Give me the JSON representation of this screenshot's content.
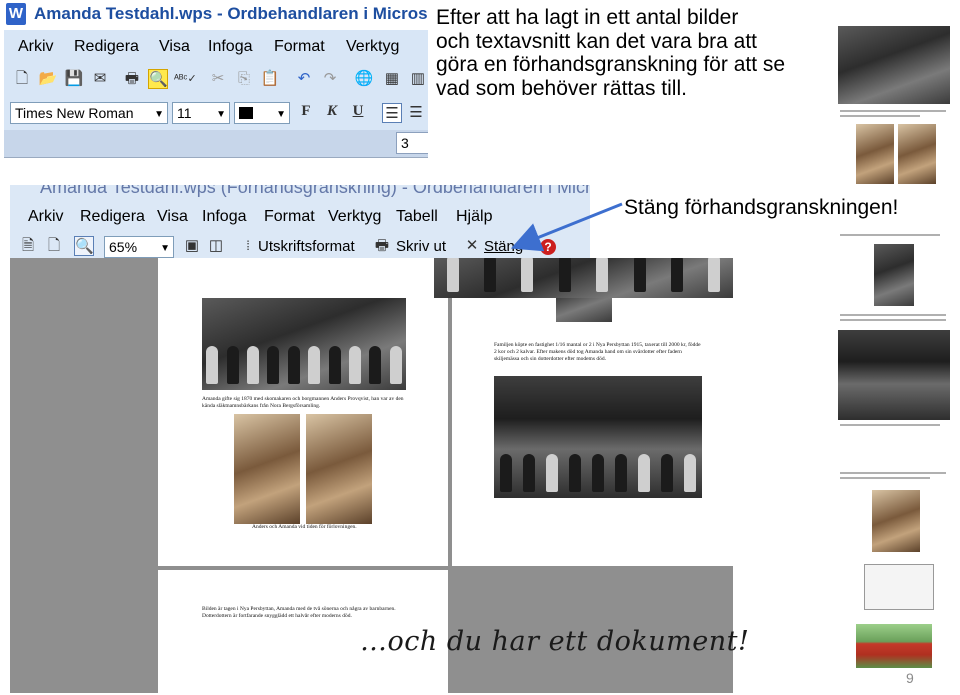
{
  "window1": {
    "title": "Amanda Testdahl.wps - Ordbehandlaren i Microsoft W",
    "menu": [
      "Arkiv",
      "Redigera",
      "Visa",
      "Infoga",
      "Format",
      "Verktyg"
    ],
    "font_name": "Times New Roman",
    "font_size": "11",
    "bold": "F",
    "italic": "K",
    "underline": "U",
    "page_number": "3"
  },
  "intro_text": [
    "Efter att ha lagt in ett antal bilder",
    "och textavsnitt kan det vara bra att",
    "göra en förhandsgranskning för att se",
    "vad som behöver rättas till."
  ],
  "window2": {
    "title": "Amanda Testdahl.wps (Förhandsgranskning) - Ordbehandlaren i Microsoft Wo",
    "menu": [
      "Arkiv",
      "Redigera",
      "Visa",
      "Infoga",
      "Format",
      "Verktyg",
      "Tabell",
      "Hjälp"
    ],
    "zoom": "65%",
    "print_layout_label": "Utskriftsformat",
    "print_label": "Skriv ut",
    "close_label": "Stäng"
  },
  "close_callout": "Stäng förhandsgranskningen!",
  "preview": {
    "page1_caption1": "Amanda gifte sig 1870 med skomakaren och borgmannen Anders Provqvist, han var av den kända släktnamnsbärkans från Nora Bergsförsamling.",
    "page1_caption2": "Anders och Amanda vid tiden för förlovningen.",
    "page2_caption": "Familjen köpte en fastighet 1/16 mantal or 2 i Nya Persbyttan 1915, taxerat till 2000 kr, födde 2 kor och 2 kalvar. Efter makens död tog Amanda hand om sin svärdotter efter fadern skiljemässa och sin dotterdotter efter modems död.",
    "page3_caption": "Bilden är tagen i Nya Persbyttan, Amanda med de två sönerna och några av barnbarnen. Dotterdottern är fortfarande snygglädd ett halvår efter moderns död."
  },
  "closing_text": "…och du har ett dokument!",
  "slide_number": "9",
  "colors": {
    "title_blue": "#1d4ea0",
    "toolbar_bg": "#d8e6f6",
    "preview_bg": "#8f8f8f",
    "arrow_blue": "#3d6fcf"
  }
}
